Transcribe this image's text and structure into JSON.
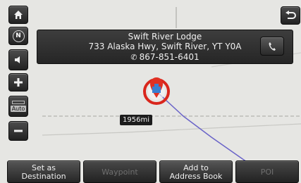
{
  "colors": {
    "map_background": "#e6e6e3",
    "road_grey": "#b8b8b4",
    "route_blue": "#6a64c8",
    "marker_red": "#d9261c",
    "marker_blue": "#3a7fd0"
  },
  "side_controls": [
    {
      "name": "home-button",
      "icon": "home-icon"
    },
    {
      "name": "north-up-button",
      "icon": "compass-north-icon",
      "label": "N"
    },
    {
      "name": "volume-button",
      "icon": "speaker-icon"
    },
    {
      "name": "zoom-in-button",
      "icon": "plus-icon"
    },
    {
      "name": "auto-zoom-button",
      "icon": "auto-zoom-icon",
      "label": "Auto"
    },
    {
      "name": "zoom-out-button",
      "icon": "minus-icon"
    }
  ],
  "north_label": "N",
  "auto_label": "Auto",
  "back_button": {
    "icon": "back-arrow-icon"
  },
  "poi": {
    "name": "Swift River Lodge",
    "address": "733 Alaska Hwy, Swift River, YT Y0A",
    "phone": "867-851-6401",
    "call_icon": "phone-icon"
  },
  "distance_label": "1956mi",
  "bottom_buttons": [
    {
      "name": "set-as-destination-button",
      "label": "Set as\nDestination",
      "enabled": true
    },
    {
      "name": "waypoint-button",
      "label": "Waypoint",
      "enabled": false
    },
    {
      "name": "add-to-address-book-button",
      "label": "Add to\nAddress Book",
      "enabled": true
    },
    {
      "name": "poi-button",
      "label": "POI",
      "enabled": false
    }
  ]
}
